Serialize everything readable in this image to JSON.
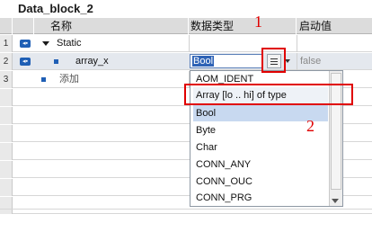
{
  "block_title": "Data_block_2",
  "columns": {
    "name": "名称",
    "type": "数据类型",
    "start": "启动值"
  },
  "rows": [
    {
      "num": "1",
      "name": "Static"
    },
    {
      "num": "2",
      "name": "array_x",
      "type_value": "Bool",
      "start_value": "false"
    },
    {
      "num": "3",
      "name": "添加"
    }
  ],
  "dropdown": {
    "items": [
      "AOM_IDENT",
      "Array [lo .. hi] of type",
      "Bool",
      "Byte",
      "Char",
      "CONN_ANY",
      "CONN_OUC",
      "CONN_PRG"
    ],
    "selected": "Bool"
  },
  "annotations": {
    "label_1": "1",
    "label_2": "2",
    "color": "#e00000"
  },
  "icons": {
    "interface": "interface-io-icon",
    "expand": "expand-triangle-icon",
    "element": "element-bullet-icon",
    "list": "list-selection-icon",
    "dropdown": "dropdown-arrow-icon",
    "scroll": "scroll-down-icon"
  }
}
